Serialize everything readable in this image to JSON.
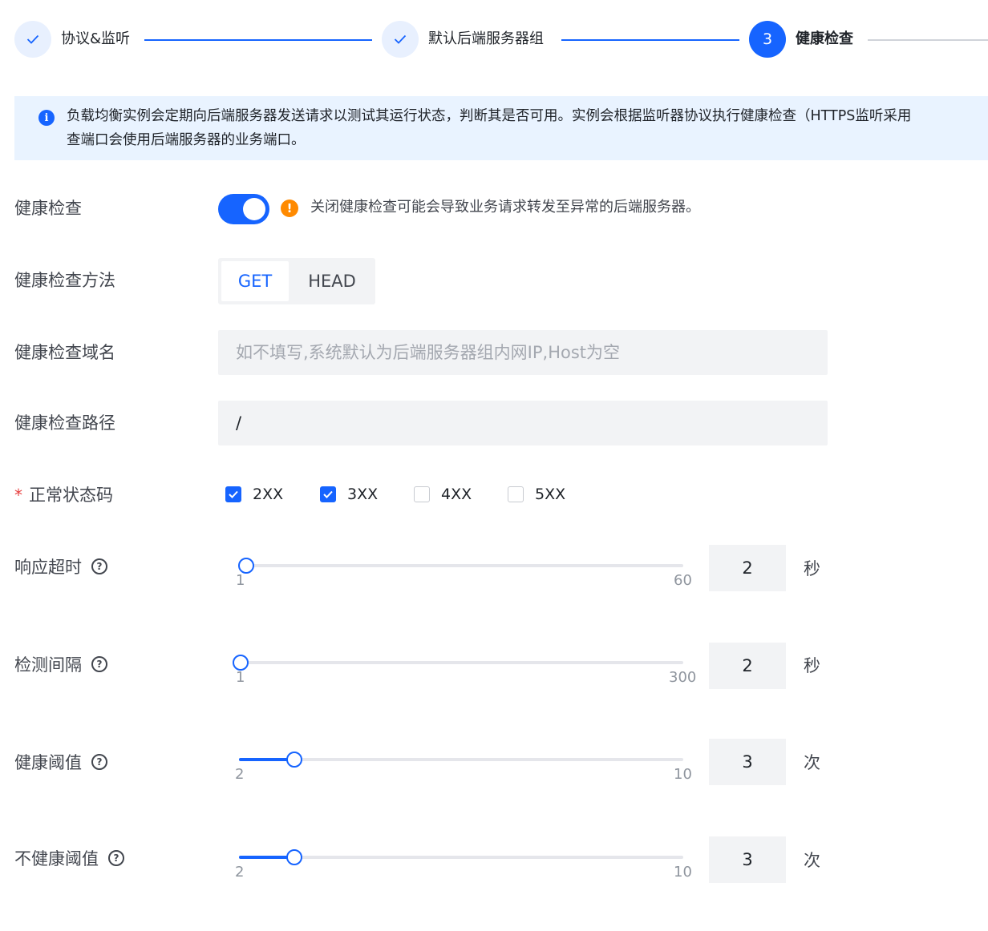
{
  "steps": [
    {
      "label": "协议&监听",
      "status": "done"
    },
    {
      "label": "默认后端服务器组",
      "status": "done"
    },
    {
      "number": "3",
      "label": "健康检查",
      "status": "active"
    }
  ],
  "banner": {
    "line1": "负载均衡实例会定期向后端服务器发送请求以测试其运行状态，判断其是否可用。实例会根据监听器协议执行健康检查（HTTPS监听采用",
    "line2": "查端口会使用后端服务器的业务端口。"
  },
  "form": {
    "health_check": {
      "label": "健康检查",
      "enabled": true,
      "warning": "关闭健康检查可能会导致业务请求转发至异常的后端服务器。"
    },
    "method": {
      "label": "健康检查方法",
      "options": [
        "GET",
        "HEAD"
      ],
      "selected": "GET"
    },
    "domain": {
      "label": "健康检查域名",
      "value": "",
      "placeholder": "如不填写,系统默认为后端服务器组内网IP,Host为空"
    },
    "path": {
      "label": "健康检查路径",
      "value": "/"
    },
    "status_codes": {
      "label": "正常状态码",
      "required_mark": "*",
      "options": [
        {
          "label": "2XX",
          "checked": true
        },
        {
          "label": "3XX",
          "checked": true
        },
        {
          "label": "4XX",
          "checked": false
        },
        {
          "label": "5XX",
          "checked": false
        }
      ]
    },
    "timeout": {
      "label": "响应超时",
      "help": "?",
      "min": "1",
      "max": "60",
      "value": "2",
      "unit": "秒"
    },
    "interval": {
      "label": "检测间隔",
      "help": "?",
      "min": "1",
      "max": "300",
      "value": "2",
      "unit": "秒"
    },
    "healthy_threshold": {
      "label": "健康阈值",
      "help": "?",
      "min": "2",
      "max": "10",
      "value": "3",
      "unit": "次"
    },
    "unhealthy_threshold": {
      "label": "不健康阈值",
      "help": "?",
      "min": "2",
      "max": "10",
      "value": "3",
      "unit": "次"
    }
  },
  "icons": {
    "check": "check-icon",
    "info": "info-icon",
    "warning": "warning-icon",
    "help": "help-icon"
  },
  "colors": {
    "primary": "#1664ff",
    "warning": "#ff8a00",
    "required": "#e63f3f"
  }
}
